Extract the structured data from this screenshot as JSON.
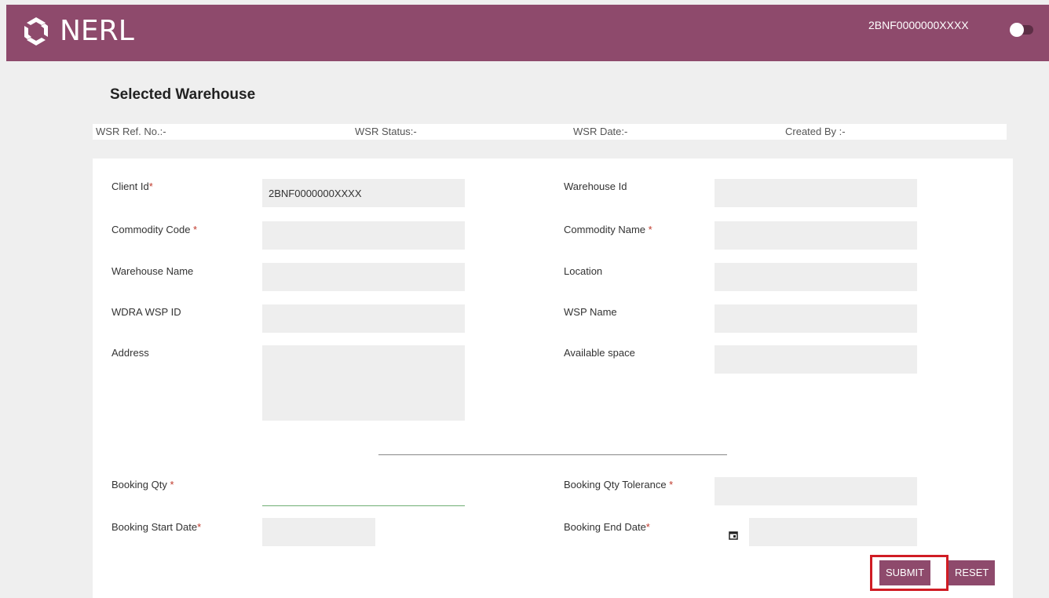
{
  "header": {
    "brand": "NERL",
    "user_id": "2BNF0000000XXXX"
  },
  "page": {
    "section_title": "Selected Warehouse",
    "meta": {
      "ref_no": "WSR Ref. No.:-",
      "status": "WSR Status:-",
      "date": "WSR Date:-",
      "created_by": "Created By :-"
    }
  },
  "form": {
    "client_id": {
      "label": "Client Id",
      "value": "2BNF0000000XXXX"
    },
    "warehouse_id": {
      "label": "Warehouse Id",
      "value": ""
    },
    "commodity_code": {
      "label": "Commodity Code ",
      "value": ""
    },
    "commodity_name": {
      "label": "Commodity Name ",
      "value": ""
    },
    "warehouse_name": {
      "label": "Warehouse Name",
      "value": ""
    },
    "location": {
      "label": "Location",
      "value": ""
    },
    "wdra_wsp_id": {
      "label": "WDRA WSP ID",
      "value": ""
    },
    "wsp_name": {
      "label": "WSP Name",
      "value": ""
    },
    "address": {
      "label": "Address",
      "value": ""
    },
    "available_space": {
      "label": "Available space",
      "value": ""
    },
    "booking_qty": {
      "label": "Booking Qty ",
      "value": ""
    },
    "booking_qty_tolerance": {
      "label": "Booking Qty Tolerance ",
      "value": ""
    },
    "booking_start_date": {
      "label": "Booking Start Date",
      "value": ""
    },
    "booking_end_date": {
      "label": "Booking End Date",
      "value": ""
    },
    "required_mark": "*"
  },
  "buttons": {
    "submit": "SUBMIT",
    "reset": "RESET"
  },
  "colors": {
    "brand": "#8e4a6c",
    "required": "#c0392b",
    "highlight": "#d01c24",
    "focus_underline": "#6fae73"
  }
}
